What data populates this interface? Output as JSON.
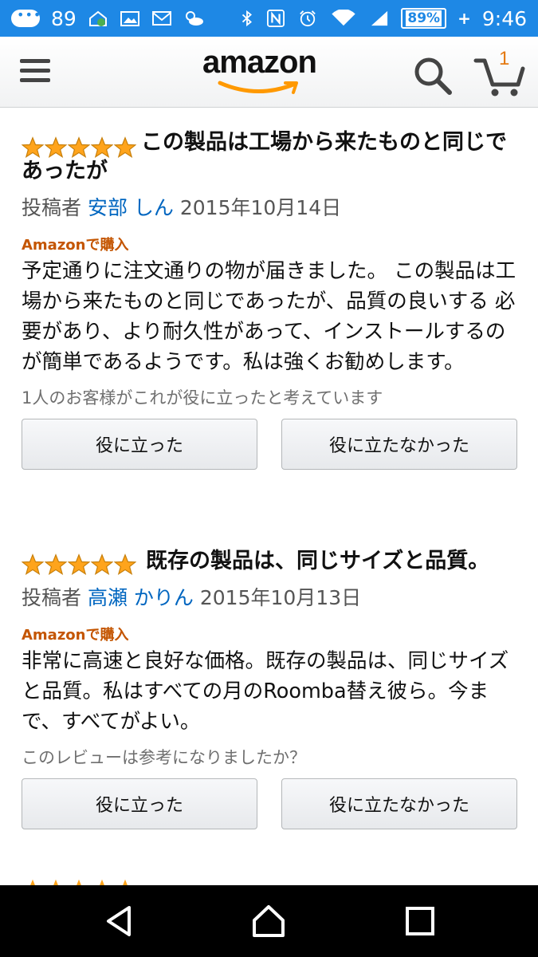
{
  "status_bar": {
    "notification_count": "89",
    "battery": "89%",
    "time": "9:46"
  },
  "header": {
    "logo_text": "amazon",
    "cart_count": "1"
  },
  "reviews": [
    {
      "stars": 5,
      "title": "この製品は工場から来たものと同じであったが",
      "author_prefix": "投稿者",
      "author": "安部 しん",
      "date": "2015年10月14日",
      "verified": "Amazonで購入",
      "body": "予定通りに注文通りの物が届きました。 この製品は工場から来たものと同じであったが、品質の良いする 必要があり、より耐久性があって、インストールするのが簡単であるようです。私は強くお勧めします。",
      "helpful_text": "1人のお客様がこれが役に立ったと考えています",
      "btn_yes": "役に立った",
      "btn_no": "役に立たなかった"
    },
    {
      "stars": 5,
      "title": "既存の製品は、同じサイズと品質。",
      "author_prefix": "投稿者",
      "author": "高瀬 かりん",
      "date": "2015年10月13日",
      "verified": "Amazonで購入",
      "body": "非常に高速と良好な価格。既存の製品は、同じサイズと品質。私はすべての月のRoomba替え彼ら。今まで、すべてがよい。",
      "helpful_text": "このレビューは参考になりましたか？",
      "btn_yes": "役に立った",
      "btn_no": "役に立たなかった"
    }
  ],
  "colors": {
    "status_bar": "#1e88e5",
    "star": "#ffa41c",
    "link": "#0066c0",
    "verified": "#c45500",
    "cart_count": "#e47911"
  },
  "icons": {
    "menu": "hamburger-icon",
    "search": "search-icon",
    "cart": "cart-icon",
    "back": "back-icon",
    "home": "home-icon",
    "recents": "recents-icon"
  }
}
